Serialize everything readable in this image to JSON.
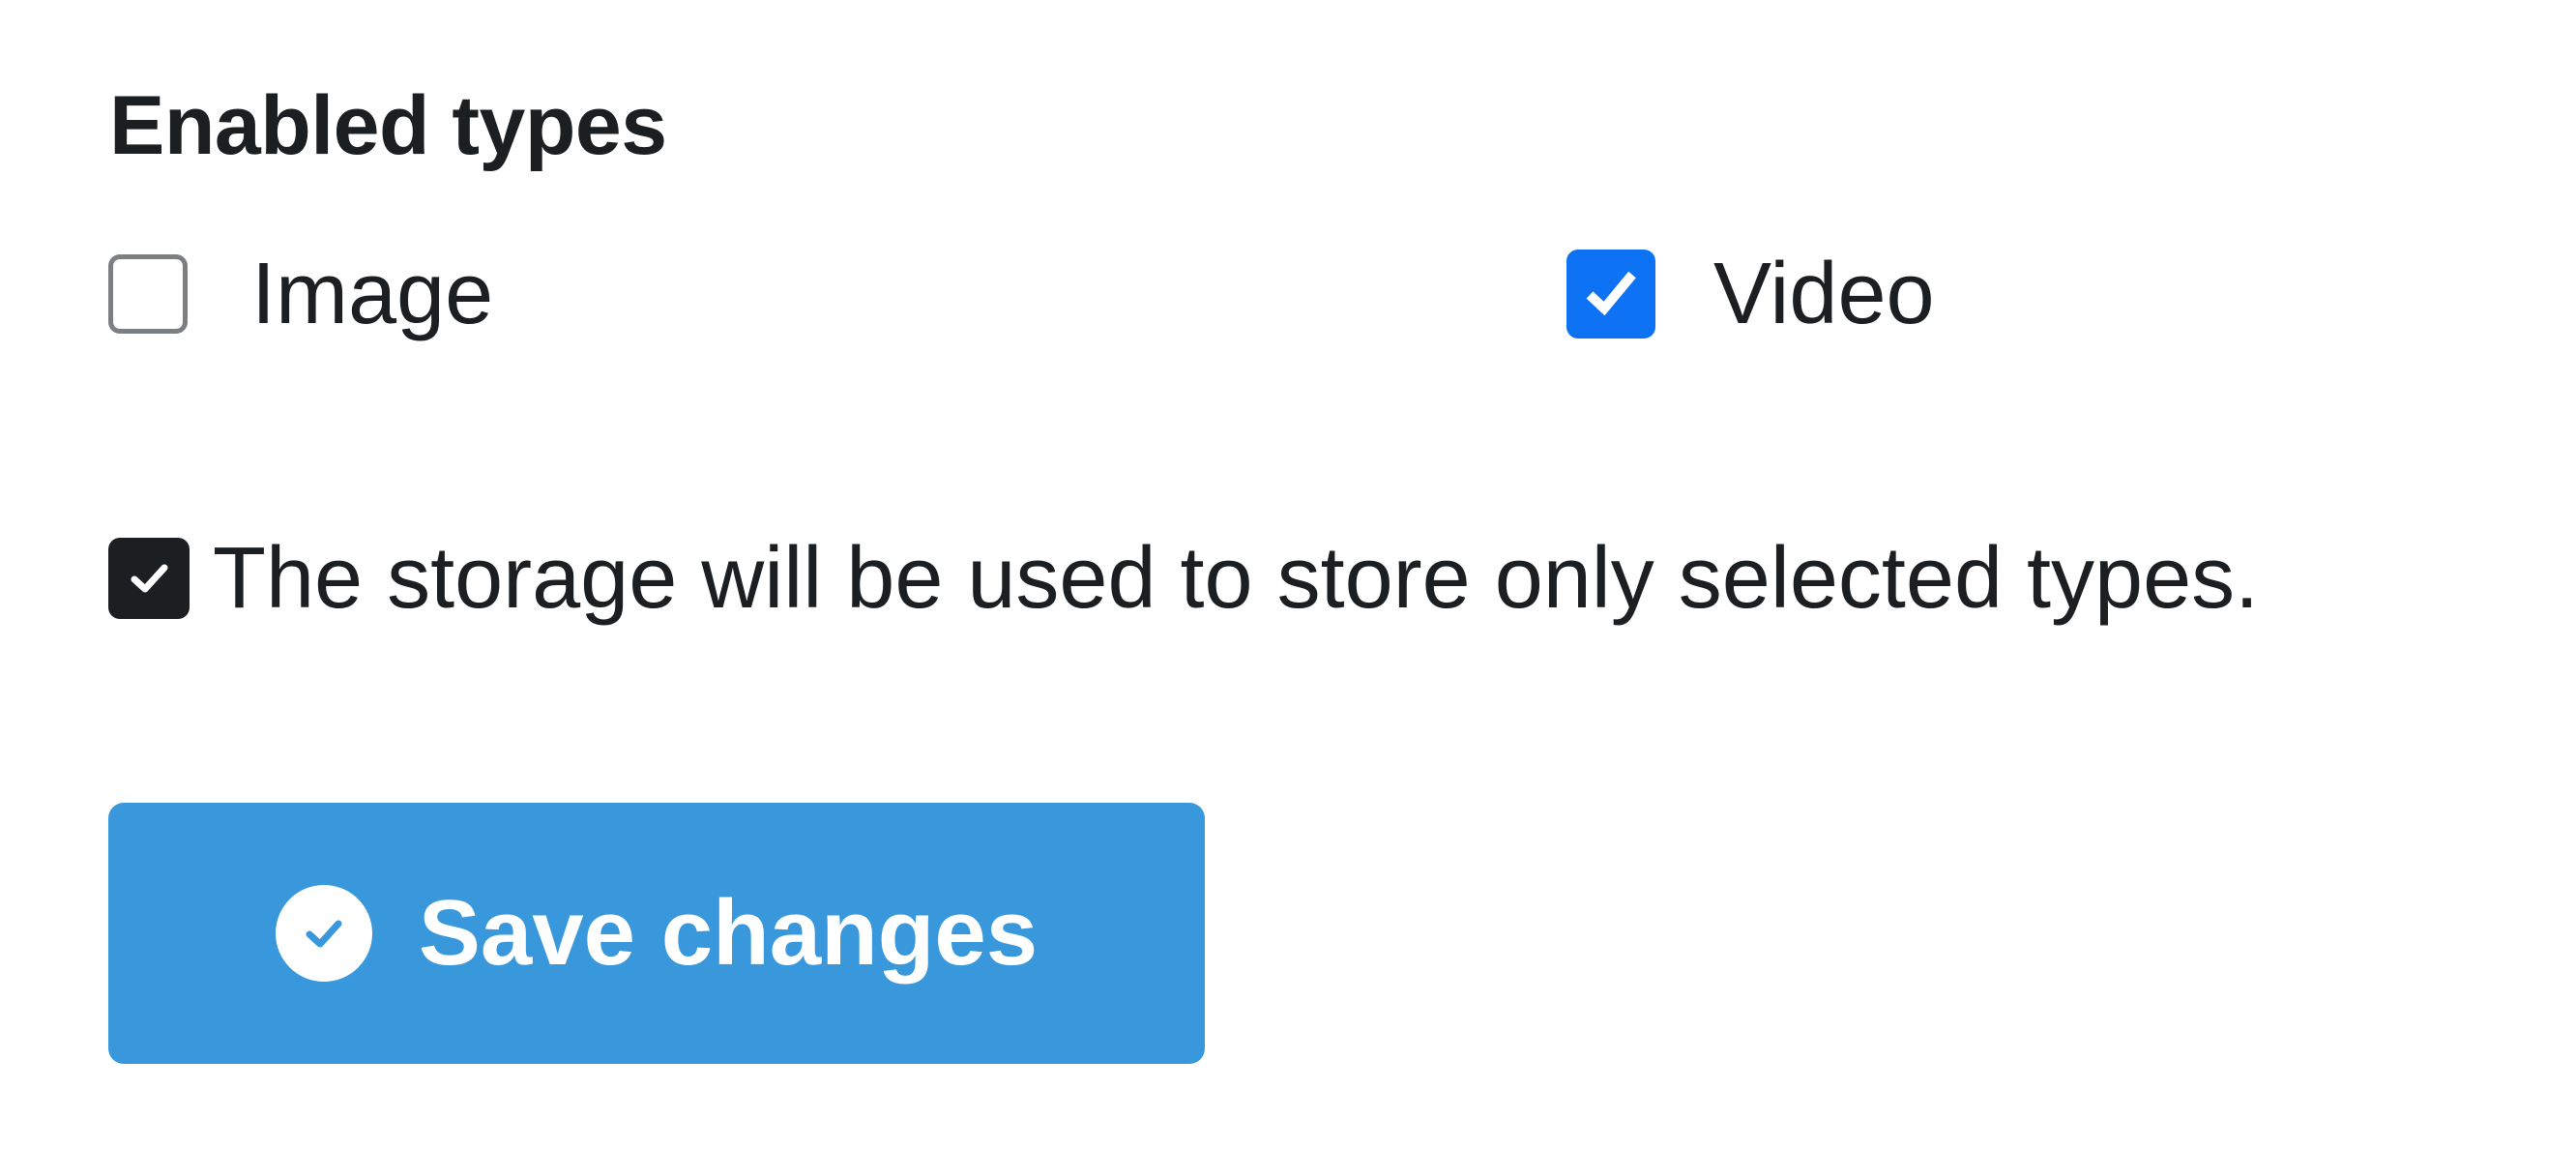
{
  "section": {
    "title": "Enabled types"
  },
  "options": [
    {
      "label": "Image",
      "checked": false
    },
    {
      "label": "Video",
      "checked": true
    }
  ],
  "note": {
    "text": "The storage will be used to store only selected types.",
    "icon": "check-icon"
  },
  "actions": {
    "save_label": "Save changes",
    "save_icon": "check-circle-icon"
  },
  "colors": {
    "checkbox_checked": "#0d72f4",
    "button_bg": "#3898db",
    "text": "#1b1f22",
    "checkbox_border": "#7c7f82"
  }
}
